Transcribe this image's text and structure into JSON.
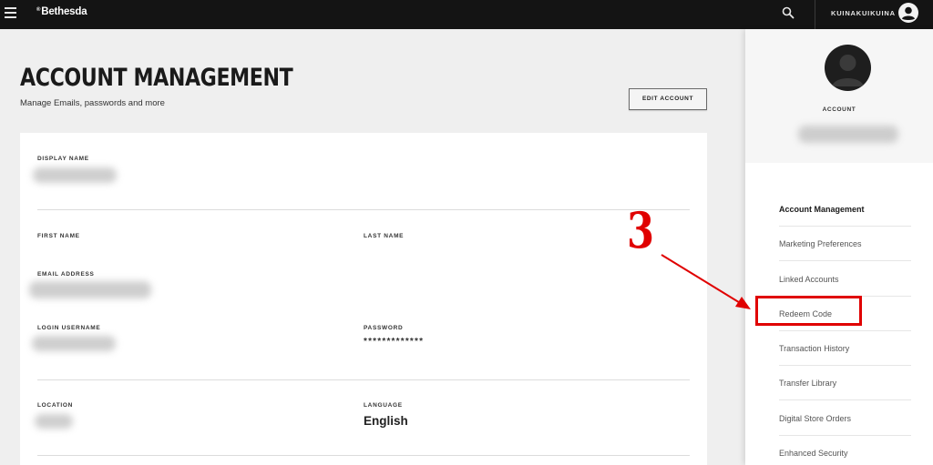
{
  "topbar": {
    "brand_mark": "®",
    "brand": "Bethesda",
    "username": "KUINAKUIKUINA"
  },
  "main": {
    "title": "ACCOUNT MANAGEMENT",
    "subtitle": "Manage Emails, passwords and more",
    "edit_button": "EDIT ACCOUNT",
    "fields": {
      "display_name_label": "DISPLAY NAME",
      "first_name_label": "FIRST NAME",
      "last_name_label": "LAST NAME",
      "email_label": "EMAIL ADDRESS",
      "login_username_label": "LOGIN USERNAME",
      "password_label": "PASSWORD",
      "password_value": "*************",
      "location_label": "LOCATION",
      "language_label": "LANGUAGE",
      "language_value": "English"
    }
  },
  "annotation": {
    "step_number": "3",
    "color": "#e00000"
  },
  "sidebar": {
    "account_label": "ACCOUNT",
    "items": [
      {
        "label": "Account Management"
      },
      {
        "label": "Marketing Preferences"
      },
      {
        "label": "Linked Accounts"
      },
      {
        "label": "Redeem Code"
      },
      {
        "label": "Transaction History"
      },
      {
        "label": "Transfer Library"
      },
      {
        "label": "Digital Store Orders"
      },
      {
        "label": "Enhanced Security"
      }
    ]
  },
  "colors": {
    "topbar": "#141414",
    "page_bg": "#efefef",
    "highlight": "#e00000"
  }
}
